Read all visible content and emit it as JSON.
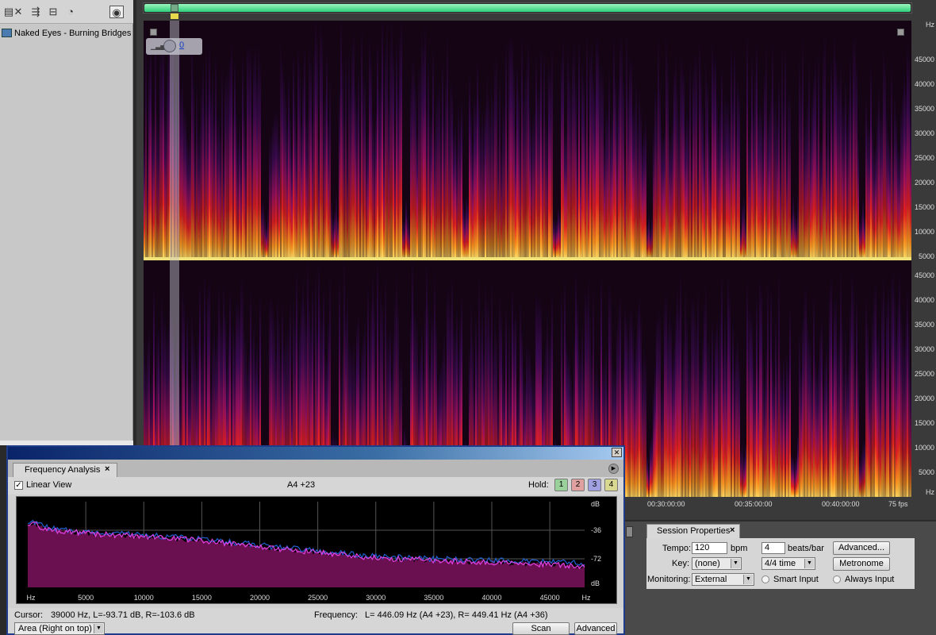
{
  "file_panel": {
    "file_name": "Naked Eyes - Burning Bridges.wav"
  },
  "spectrogram": {
    "volume_value": "0",
    "hz_unit": "Hz",
    "hz_ticks_top": [
      "45000",
      "40000",
      "35000",
      "30000",
      "25000",
      "20000",
      "15000",
      "10000",
      "5000"
    ],
    "hz_ticks_bottom": [
      "45000",
      "40000",
      "35000",
      "30000",
      "25000",
      "20000",
      "15000",
      "10000",
      "5000"
    ],
    "time_ticks": [
      "00:30:00:00",
      "00:35:00:00",
      "00:40:00:00"
    ],
    "fps": "75 fps",
    "colors": {
      "background": "#150514",
      "hot": "#ffb030",
      "warm": "#e02020",
      "cool": "#5a1070"
    }
  },
  "session_properties": {
    "tab_label": "Session Properties",
    "tempo_label": "Tempo:",
    "tempo_value": "120",
    "bpm_label": "bpm",
    "beats_value": "4",
    "beats_label": "beats/bar",
    "advanced_button": "Advanced...",
    "key_label": "Key:",
    "key_value": "(none)",
    "time_sig_value": "4/4 time",
    "metronome_button": "Metronome",
    "monitoring_label": "Monitoring:",
    "monitoring_value": "External",
    "smart_input_label": "Smart Input",
    "always_input_label": "Always Input"
  },
  "frequency_analysis": {
    "tab_label": "Frequency Analysis",
    "linear_view_label": "Linear View",
    "linear_view_checked": true,
    "note": "A4 +23",
    "hold_label": "Hold:",
    "hold_buttons": [
      "1",
      "2",
      "3",
      "4"
    ],
    "hold_colors": [
      "#9ad09a",
      "#e0a0a0",
      "#a0a0e0",
      "#d8d890"
    ],
    "db_labels": [
      "dB",
      "-36",
      "-72",
      "dB"
    ],
    "x_labels": [
      "Hz",
      "5000",
      "10000",
      "15000",
      "20000",
      "25000",
      "30000",
      "35000",
      "40000",
      "45000",
      "Hz"
    ],
    "cursor_label": "Cursor:",
    "cursor_value": "39000 Hz, L=-93.71 dB, R=-103.6 dB",
    "frequency_label": "Frequency:",
    "frequency_value": "L= 446.09 Hz (A4 +23), R= 449.41 Hz (A4 +36)",
    "area_select_value": "Area (Right on top)",
    "scan_selection_button": "Scan selection",
    "advanced_button": "Advanced",
    "chart_data": {
      "type": "area",
      "x_range": [
        0,
        48000
      ],
      "y_range_db": [
        -108,
        0
      ],
      "series": [
        {
          "color": "#2060d0",
          "x": [
            0,
            2000,
            5000,
            10000,
            15000,
            20000,
            25000,
            30000,
            35000,
            40000,
            45000,
            48000
          ],
          "y": [
            -24,
            -34,
            -38,
            -42,
            -47,
            -55,
            -62,
            -69,
            -72,
            -74,
            -76,
            -78
          ]
        },
        {
          "color": "#e040e0",
          "x": [
            0,
            2000,
            5000,
            10000,
            15000,
            20000,
            25000,
            30000,
            35000,
            40000,
            45000,
            48000
          ],
          "y": [
            -26,
            -36,
            -40,
            -44,
            -49,
            -57,
            -64,
            -71,
            -74,
            -77,
            -79,
            -82
          ]
        }
      ],
      "fill_color": "#6a1050"
    }
  }
}
